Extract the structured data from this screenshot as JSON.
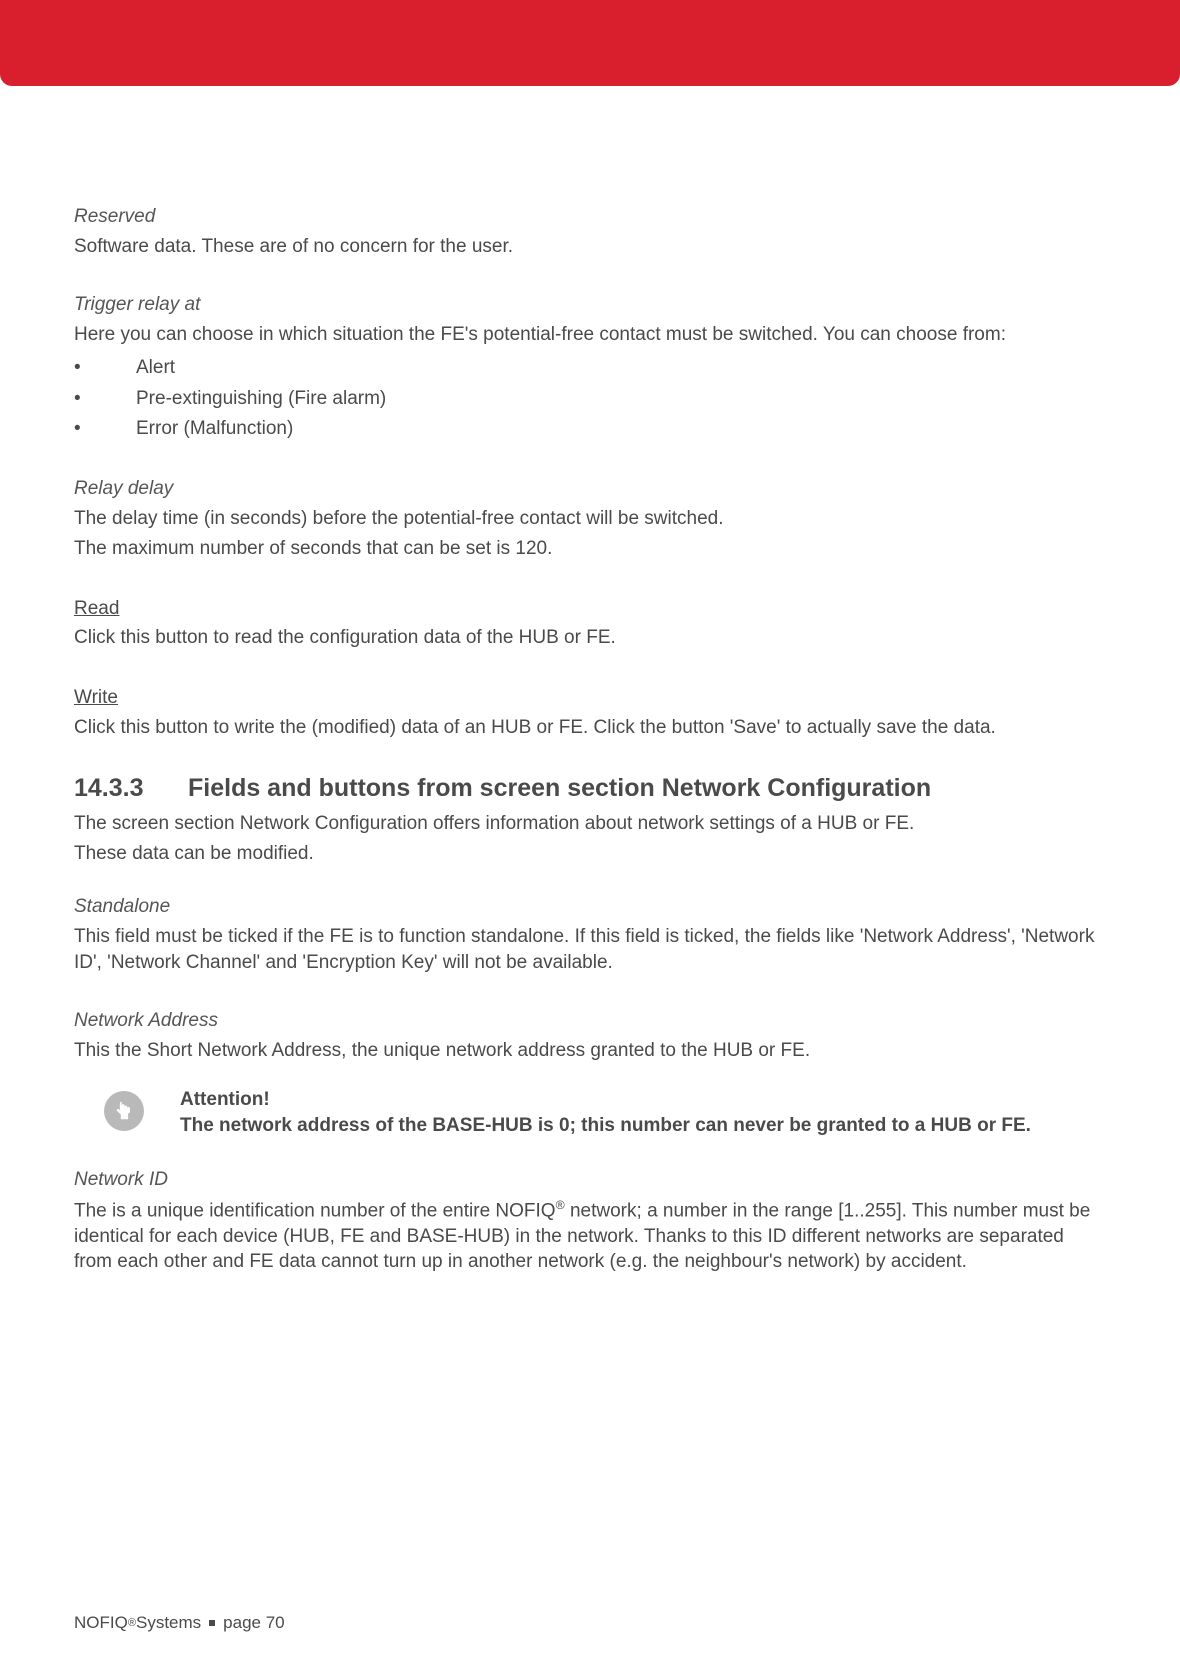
{
  "sections": {
    "reserved": {
      "title": "Reserved",
      "body": "Software data. These are of no concern for the user."
    },
    "trigger_relay_at": {
      "title": "Trigger relay at",
      "intro": "Here you can choose in which situation the FE's potential-free contact must be switched. You can choose from:",
      "items": [
        "Alert",
        "Pre-extinguishing (Fire alarm)",
        "Error (Malfunction)"
      ]
    },
    "relay_delay": {
      "title": "Relay delay",
      "line1": "The delay time (in seconds) before the potential-free contact will be switched.",
      "line2": "The maximum number of seconds that can be set is 120."
    },
    "read": {
      "title": "Read",
      "body": "Click this button to read the configuration data of the HUB or FE."
    },
    "write": {
      "title": "Write",
      "body": "Click this button to write the (modified) data of an HUB or FE. Click the button 'Save' to actually save the data."
    },
    "heading_14_3_3": {
      "number": "14.3.3",
      "text": "Fields and buttons from screen section Network Configuration",
      "intro1": "The screen section Network Configuration offers information about network settings of a HUB or FE.",
      "intro2": "These data can be modified."
    },
    "standalone": {
      "title": "Standalone",
      "body": "This field must be ticked if the FE is to function standalone. If this field is ticked, the fields like 'Network Address', 'Network ID', 'Network Channel' and 'Encryption Key' will not be available."
    },
    "network_address": {
      "title": "Network Address",
      "body": "This the Short Network Address, the unique network address granted to the HUB or FE."
    },
    "attention": {
      "label": "Attention!",
      "body": "The network address of the BASE-HUB is 0; this number can never be granted to a HUB or FE."
    },
    "network_id": {
      "title": "Network ID",
      "body_prefix": "The is a unique identification number of the entire NOFIQ",
      "body_suffix": " network; a number in the range [1..255]. This number must be identical for each device (HUB, FE and BASE-HUB) in the network. Thanks to this ID different networks are separated from each other and FE data cannot turn up in another network (e.g. the neighbour's network) by accident."
    }
  },
  "footer": {
    "brand": "NOFIQ",
    "systems": " Systems",
    "page_label": "page 70"
  }
}
